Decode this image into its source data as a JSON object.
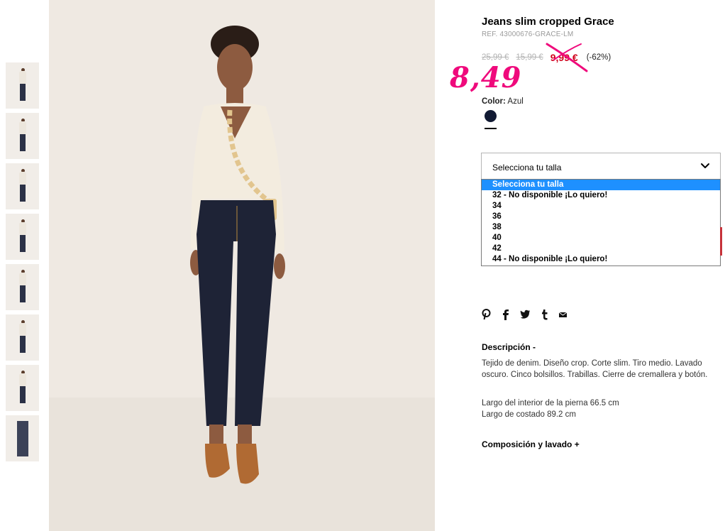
{
  "product": {
    "title": "Jeans slim cropped Grace",
    "ref": "REF. 43000676-GRACE-LM",
    "prices": {
      "old1": "25,99 €",
      "old2": "15,99 €",
      "current": "9,99 €",
      "discount": "(-62%)"
    },
    "handwritten_price": "8,49",
    "color_label": "Color:",
    "color_value": "Azul",
    "swatch_color": "#111a33"
  },
  "size_select": {
    "value": "Selecciona tu talla",
    "options": [
      "Selecciona tu talla",
      "32 - No disponible ¡Lo quiero!",
      "34",
      "36",
      "38",
      "40",
      "42",
      "44 - No disponible ¡Lo quiero!"
    ],
    "selected_index": 0
  },
  "social_icons": [
    "pinterest-icon",
    "facebook-icon",
    "twitter-icon",
    "tumblr-icon",
    "mail-icon"
  ],
  "description": {
    "heading": "Descripción -",
    "text": "Tejido de denim. Diseño crop. Corte slim. Tiro medio. Lavado oscuro. Cinco bolsillos. Trabillas. Cierre de cremallera y botón.",
    "measure1": "Largo del interior de la pierna 66.5 cm",
    "measure2": "Largo de costado 89.2 cm"
  },
  "composition_heading": "Composición y lavado +",
  "colors": {
    "accent_select": "#1e90ff",
    "sale_red": "#d0021b",
    "handwritten_pink": "#ef0a7c"
  }
}
